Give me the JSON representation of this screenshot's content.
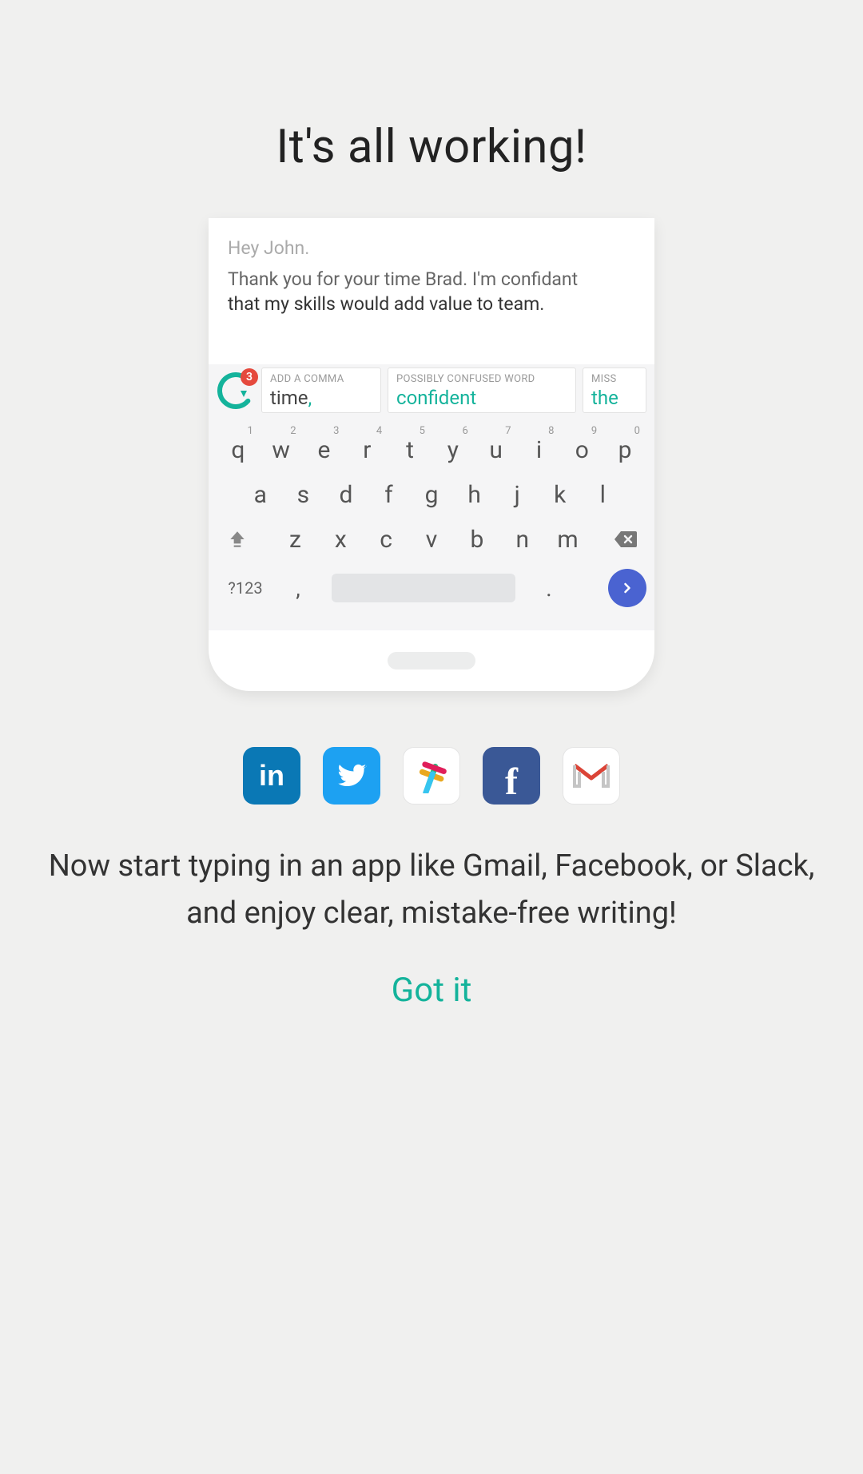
{
  "title": "It's all working!",
  "editor": {
    "greeting": "Hey John.",
    "line1": "Thank you for your time Brad. I'm confidant",
    "line2": "that my skills would add value to team."
  },
  "grammarly": {
    "badge_count": "3"
  },
  "suggestions": [
    {
      "label": "ADD A COMMA",
      "word_plain": "time",
      "word_accent": ","
    },
    {
      "label": "POSSIBLY CONFUSED WORD",
      "word_plain": "",
      "word_accent": "confident"
    },
    {
      "label": "MISS",
      "word_plain": "",
      "word_accent": "the"
    }
  ],
  "keyboard": {
    "row1": [
      {
        "k": "q",
        "n": "1"
      },
      {
        "k": "w",
        "n": "2"
      },
      {
        "k": "e",
        "n": "3"
      },
      {
        "k": "r",
        "n": "4"
      },
      {
        "k": "t",
        "n": "5"
      },
      {
        "k": "y",
        "n": "6"
      },
      {
        "k": "u",
        "n": "7"
      },
      {
        "k": "i",
        "n": "8"
      },
      {
        "k": "o",
        "n": "9"
      },
      {
        "k": "p",
        "n": "0"
      }
    ],
    "row2": [
      "a",
      "s",
      "d",
      "f",
      "g",
      "h",
      "j",
      "k",
      "l"
    ],
    "row3": [
      "z",
      "x",
      "c",
      "v",
      "b",
      "n",
      "m"
    ],
    "meta": "?123",
    "comma": ",",
    "dot": "."
  },
  "apps": {
    "linkedin": "in",
    "twitter": "twitter-icon",
    "slack": "slack-icon",
    "facebook": "f",
    "gmail": "M"
  },
  "description": "Now start typing in an app like Gmail, Facebook, or Slack, and enjoy clear, mistake-free writing!",
  "got_it": "Got it",
  "colors": {
    "accent_green": "#14b39b",
    "badge_red": "#e5493d",
    "enter_blue": "#4a63d1"
  }
}
